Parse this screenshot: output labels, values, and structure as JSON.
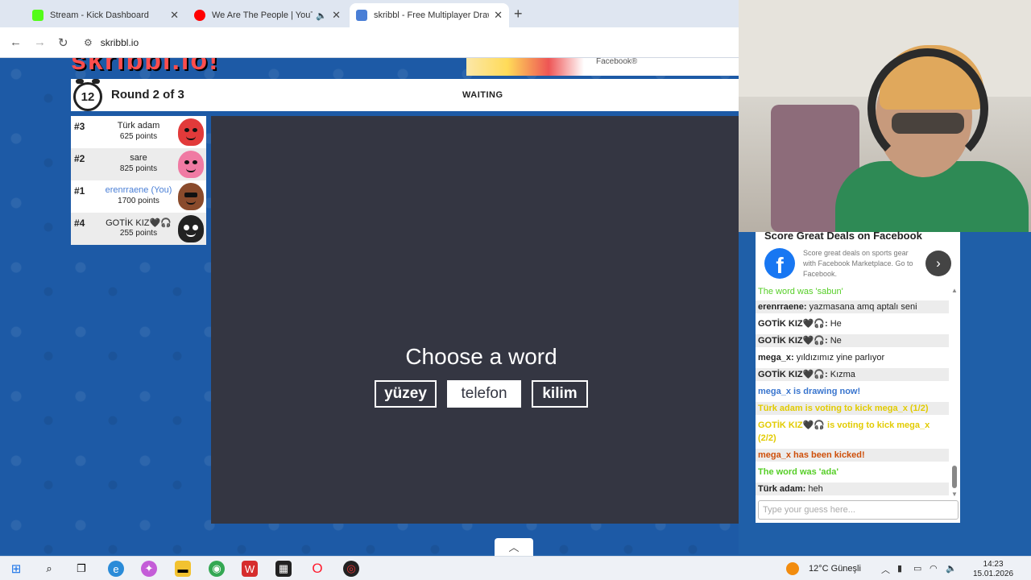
{
  "browser": {
    "tabs": [
      {
        "title": "Stream - Kick Dashboard",
        "favicon_color": "#53fc18"
      },
      {
        "title": "We Are The People | YouTu",
        "favicon_color": "#ff0000"
      },
      {
        "title": "skribbl - Free Multiplayer Draw",
        "favicon_color": "#4a7fd6"
      }
    ],
    "url": "skribbl.io"
  },
  "game": {
    "logo_text": "skribbl.io!",
    "ad_strip_text": "Facebook®",
    "timer": "12",
    "round": "Round 2 of 3",
    "status": "WAITING",
    "players": [
      {
        "rank": "#3",
        "name": "Türk adam",
        "points": "625 points",
        "avatar_color": "#e23a3a"
      },
      {
        "rank": "#2",
        "name": "sare",
        "points": "825 points",
        "avatar_color": "#f07aa3"
      },
      {
        "rank": "#1",
        "name": "erenrraene (You)",
        "points": "1700 points",
        "avatar_color": "#8a4b2c"
      },
      {
        "rank": "#4",
        "name": "GOTİK KIZ🖤🎧",
        "points": "255 points",
        "avatar_color": "#222222"
      }
    ],
    "choose_title": "Choose a word",
    "words": [
      "yüzey",
      "telefon",
      "kilim"
    ]
  },
  "chat": {
    "ad": {
      "title": "Score Great Deals on Facebook",
      "body": "Score great deals on sports gear with Facebook Marketplace. Go to Facebook.",
      "logo": "f",
      "arrow": "›"
    },
    "messages": [
      {
        "name": "",
        "text": "The word was 'sabun'",
        "kind": "green"
      },
      {
        "name": "erenrraene:",
        "text": "yazmasana amq aptalı seni",
        "kind": "normal"
      },
      {
        "name": "GOTİK KIZ🖤🎧:",
        "text": "He",
        "kind": "normal"
      },
      {
        "name": "GOTİK KIZ🖤🎧:",
        "text": "Ne",
        "kind": "normal"
      },
      {
        "name": "mega_x:",
        "text": "yıldızımız yine parlıyor",
        "kind": "normal"
      },
      {
        "name": "GOTİK KIZ🖤🎧:",
        "text": "Kızma",
        "kind": "normal"
      },
      {
        "name": "",
        "text": "mega_x is drawing now!",
        "kind": "blue"
      },
      {
        "name": "",
        "text": "Türk adam is voting to kick mega_x (1/2)",
        "kind": "yellow"
      },
      {
        "name": "",
        "text": "GOTİK KIZ🖤🎧 is voting to kick mega_x (2/2)",
        "kind": "yellow"
      },
      {
        "name": "",
        "text": "mega_x has been kicked!",
        "kind": "red"
      },
      {
        "name": "",
        "text": "The word was 'ada'",
        "kind": "green"
      },
      {
        "name": "Türk adam:",
        "text": "heh",
        "kind": "normal"
      }
    ],
    "input_placeholder": "Type your guess here..."
  },
  "taskbar": {
    "weather": "12°C Güneşli",
    "time": "14:23",
    "date": "15.01.2026"
  }
}
